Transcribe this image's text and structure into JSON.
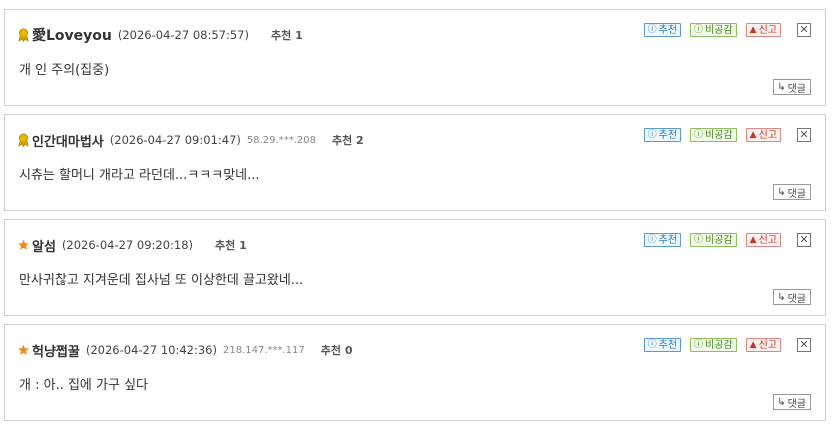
{
  "buttons": {
    "recommend": "추천",
    "not_recommend": "비공감",
    "report": "신고",
    "close": "✕",
    "reply": "댓글"
  },
  "comments": [
    {
      "icon": "gold-medal",
      "nickname": "愛Loveyou",
      "date": "(2026-04-27 08:57:57)",
      "ip": "",
      "recommend": "추천 1",
      "text": "개 인 주의(집중)"
    },
    {
      "icon": "gold-medal",
      "nickname": "인간대마법사",
      "date": "(2026-04-27 09:01:47)",
      "ip": "58.29.***.208",
      "recommend": "추천 2",
      "text": "시츄는 할머니 개라고 라던데...ㅋㅋㅋ맞네..."
    },
    {
      "icon": "orange-star",
      "nickname": "알섬",
      "date": "(2026-04-27 09:20:18)",
      "ip": "",
      "recommend": "추천 1",
      "text": "만사귀찮고 지겨운데 집사넘 또 이상한데 끌고왔네..."
    },
    {
      "icon": "orange-star",
      "nickname": "헉냥쩝꿀",
      "date": "(2026-04-27 10:42:36)",
      "ip": "218.147.***.117",
      "recommend": "추천 0",
      "text": "개 : 아.. 집에 가구 싶다"
    }
  ],
  "colors": {
    "medal": "#d9a400",
    "star": "#f08a1c",
    "recommend": "#2b7bb9",
    "not_recommend": "#4a8a1c",
    "report": "#c0392b"
  }
}
